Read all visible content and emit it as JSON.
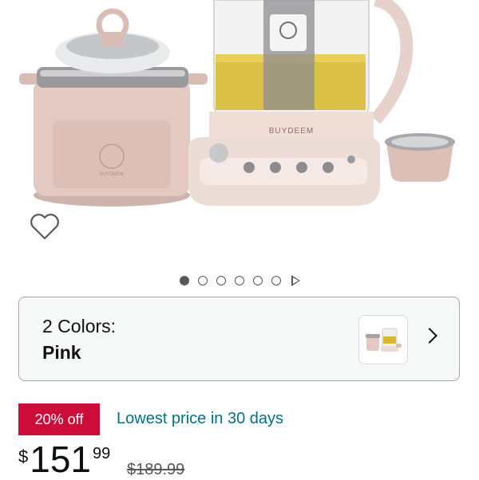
{
  "product": {
    "brand_printed": "BUYDEEM",
    "pot_brand_printed": "BUYDEEM"
  },
  "gallery": {
    "image_count": 6,
    "active_index": 0,
    "has_video": true
  },
  "variant": {
    "label": "2 Colors:",
    "selected": "Pink"
  },
  "deal": {
    "badge": "20% off",
    "text": "Lowest price in 30 days"
  },
  "price": {
    "symbol": "$",
    "whole": "151",
    "fraction": "99",
    "list_price": "$189.99"
  },
  "icons": {
    "wishlist": "heart-outline-icon",
    "video": "play-icon",
    "variant_next": "chevron-right-icon"
  },
  "colors": {
    "deal_red": "#cc0c39",
    "link_teal": "#007185",
    "card_border": "#a6a6a6",
    "pink_body": "#e3c9c1"
  }
}
